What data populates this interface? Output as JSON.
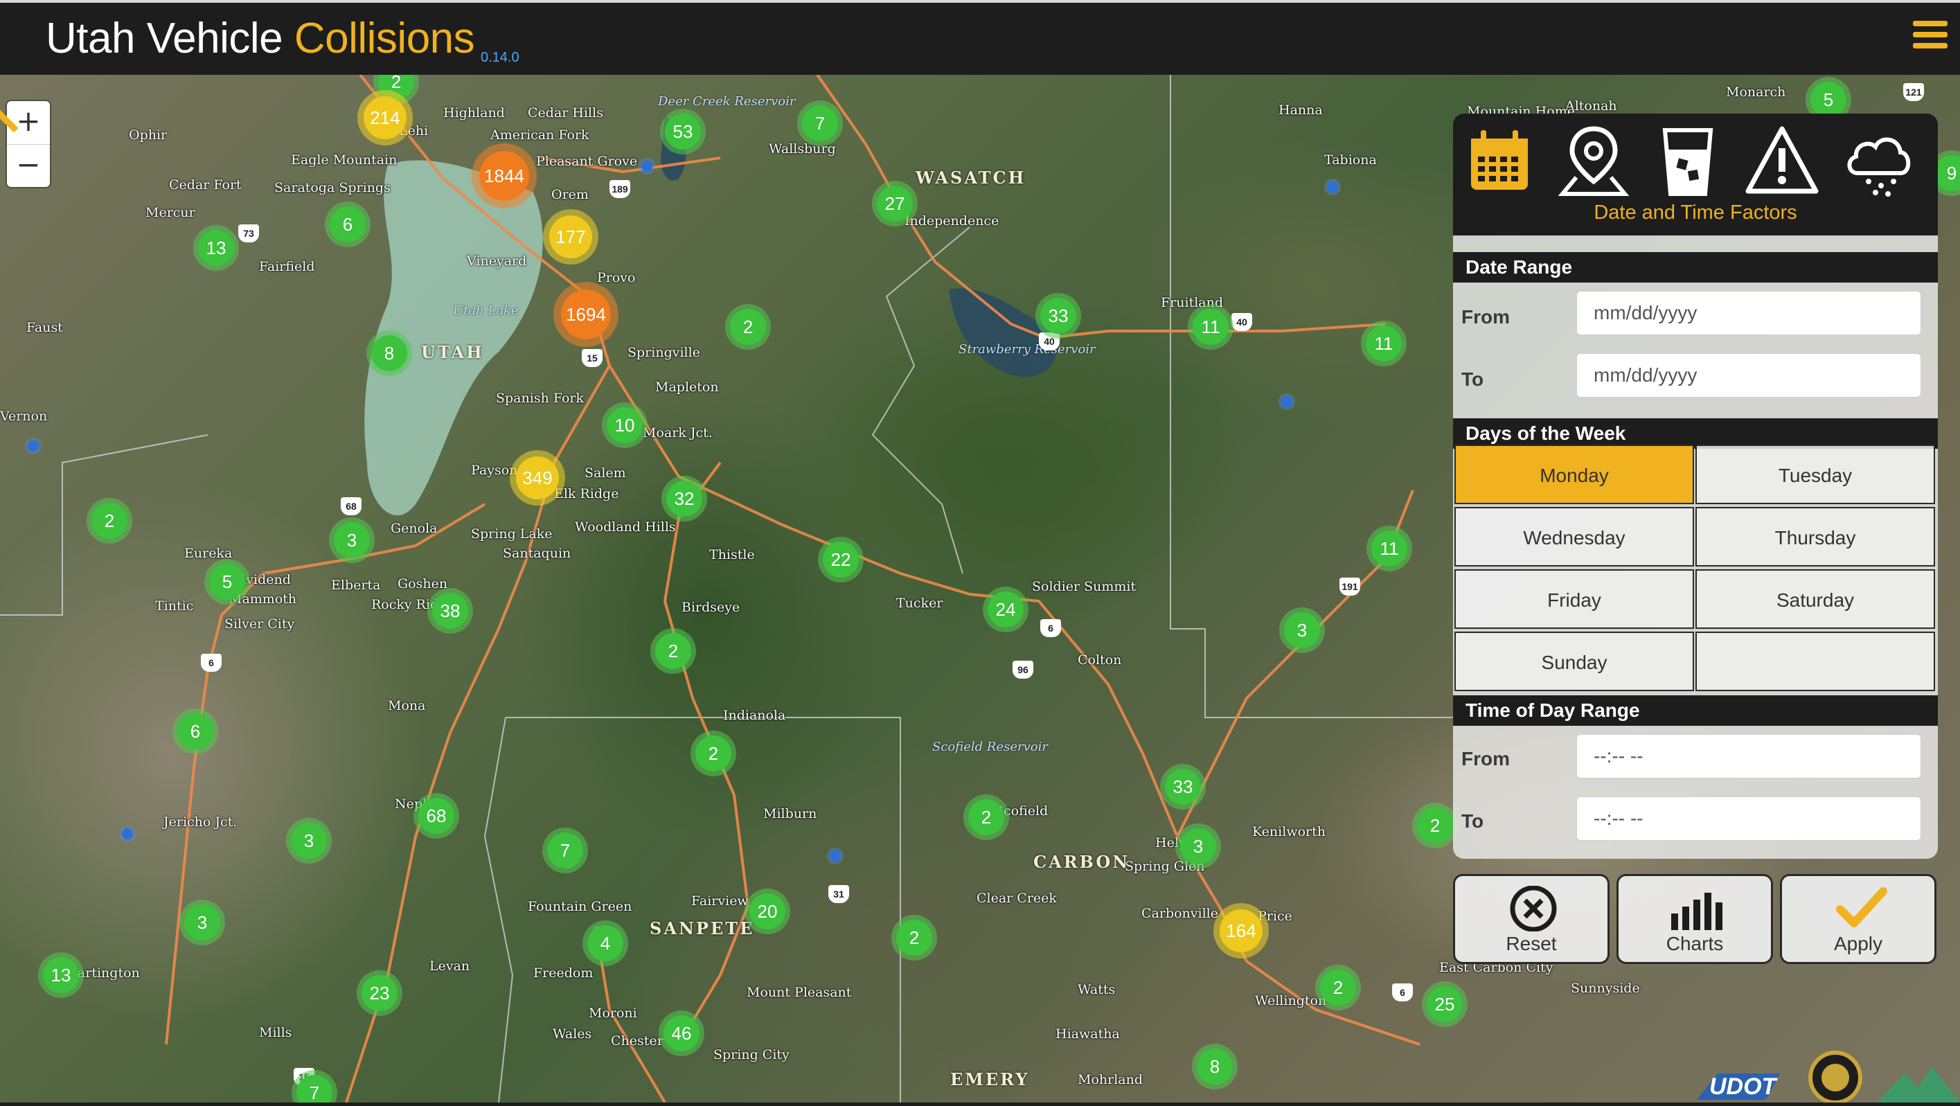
{
  "header": {
    "title_main": "Utah Vehicle ",
    "title_accent": "Collisions",
    "version": "0.14.0"
  },
  "map": {
    "zoom_in": "+",
    "zoom_out": "−",
    "places": [
      "Highland",
      "Cedar Hills",
      "American Fork",
      "Eagle Mountain",
      "Pleasant Grove",
      "Saratoga Springs",
      "Orem",
      "Cedar Fort",
      "Mercur",
      "Fairfield",
      "Vineyard",
      "Provo",
      "Faust",
      "Springville",
      "Mapleton",
      "Spanish Fork",
      "Moark Jct.",
      "Payson",
      "Salem",
      "Elk Ridge",
      "Woodland Hills",
      "Genola",
      "Spring Lake",
      "Santaquin",
      "Eureka",
      "Dividend",
      "Mammoth",
      "Elberta",
      "Goshen",
      "Rocky Ridge",
      "Tintic",
      "Silver City",
      "Mona",
      "Nephi",
      "Jericho Jct.",
      "Levan",
      "Mills",
      "Independence",
      "Wallsburg",
      "Thistle",
      "Birdseye",
      "Tucker",
      "Soldier Summit",
      "Colton",
      "Indianola",
      "Milburn",
      "Fairview",
      "Fountain Green",
      "Freedom",
      "Moroni",
      "Wales",
      "Chester",
      "Mount Pleasant",
      "Spring City",
      "Scofield",
      "Helper",
      "Spring Glen",
      "Clear Creek",
      "Carbonville",
      "Price",
      "Kenilworth",
      "Wellington",
      "Watts",
      "Hiawatha",
      "Mohrland",
      "East Carbon City",
      "Sunnyside",
      "Fruitland",
      "Hanna",
      "Tabiona",
      "Altonah",
      "Mountain Home",
      "Monarch",
      "Ophir",
      "Vernon",
      "Lehi",
      "Partington"
    ],
    "regions": [
      "WASATCH",
      "UTAH",
      "SANPETE",
      "CARBON",
      "EMERY"
    ],
    "waters": [
      "Deer Creek Reservoir",
      "Utah Lake",
      "Strawberry Reservoir",
      "Scofield Reservoir"
    ],
    "clusters": [
      {
        "label": "2",
        "size": "small"
      },
      {
        "label": "214",
        "size": "medium"
      },
      {
        "label": "53",
        "size": "small"
      },
      {
        "label": "7",
        "size": "small"
      },
      {
        "label": "1844",
        "size": "large"
      },
      {
        "label": "177",
        "size": "medium"
      },
      {
        "label": "27",
        "size": "small"
      },
      {
        "label": "13",
        "size": "small"
      },
      {
        "label": "6",
        "size": "small"
      },
      {
        "label": "1694",
        "size": "large"
      },
      {
        "label": "2",
        "size": "small"
      },
      {
        "label": "33",
        "size": "small"
      },
      {
        "label": "11",
        "size": "small"
      },
      {
        "label": "11",
        "size": "small"
      },
      {
        "label": "8",
        "size": "small"
      },
      {
        "label": "10",
        "size": "small"
      },
      {
        "label": "349",
        "size": "medium"
      },
      {
        "label": "32",
        "size": "small"
      },
      {
        "label": "2",
        "size": "small"
      },
      {
        "label": "3",
        "size": "small"
      },
      {
        "label": "22",
        "size": "small"
      },
      {
        "label": "11",
        "size": "small"
      },
      {
        "label": "5",
        "size": "small"
      },
      {
        "label": "38",
        "size": "small"
      },
      {
        "label": "24",
        "size": "small"
      },
      {
        "label": "3",
        "size": "small"
      },
      {
        "label": "2",
        "size": "small"
      },
      {
        "label": "6",
        "size": "small"
      },
      {
        "label": "2",
        "size": "small"
      },
      {
        "label": "33",
        "size": "small"
      },
      {
        "label": "68",
        "size": "small"
      },
      {
        "label": "2",
        "size": "small"
      },
      {
        "label": "3",
        "size": "small"
      },
      {
        "label": "3",
        "size": "small"
      },
      {
        "label": "2",
        "size": "small"
      },
      {
        "label": "7",
        "size": "small"
      },
      {
        "label": "3",
        "size": "small"
      },
      {
        "label": "20",
        "size": "small"
      },
      {
        "label": "4",
        "size": "small"
      },
      {
        "label": "2",
        "size": "small"
      },
      {
        "label": "164",
        "size": "medium"
      },
      {
        "label": "13",
        "size": "small"
      },
      {
        "label": "23",
        "size": "small"
      },
      {
        "label": "2",
        "size": "small"
      },
      {
        "label": "25",
        "size": "small"
      },
      {
        "label": "46",
        "size": "small"
      },
      {
        "label": "8",
        "size": "small"
      },
      {
        "label": "7",
        "size": "small"
      },
      {
        "label": "5",
        "size": "small"
      },
      {
        "label": "9",
        "size": "small"
      }
    ]
  },
  "panel": {
    "categories": [
      "calendar-icon",
      "location-pin-icon",
      "drink-icon",
      "warning-icon",
      "weather-icon"
    ],
    "active_category": "Date and Time Factors",
    "date_range": {
      "header": "Date Range",
      "from_label": "From",
      "to_label": "To",
      "from_placeholder": "mm/dd/yyyy",
      "to_placeholder": "mm/dd/yyyy"
    },
    "days": {
      "header": "Days of the Week",
      "items": [
        "Monday",
        "Tuesday",
        "Wednesday",
        "Thursday",
        "Friday",
        "Saturday",
        "Sunday"
      ],
      "selected": "Monday"
    },
    "time_range": {
      "header": "Time of Day Range",
      "from_label": "From",
      "to_label": "To",
      "from_placeholder": "--:-- --",
      "to_placeholder": "--:-- --"
    },
    "actions": {
      "reset": "Reset",
      "charts": "Charts",
      "apply": "Apply"
    }
  },
  "colors": {
    "accent": "#f0b21e",
    "cluster_small": "#3cc23c",
    "cluster_medium": "#efc91d",
    "cluster_large": "#f07c1e",
    "header_bg": "#1d1d1d"
  }
}
